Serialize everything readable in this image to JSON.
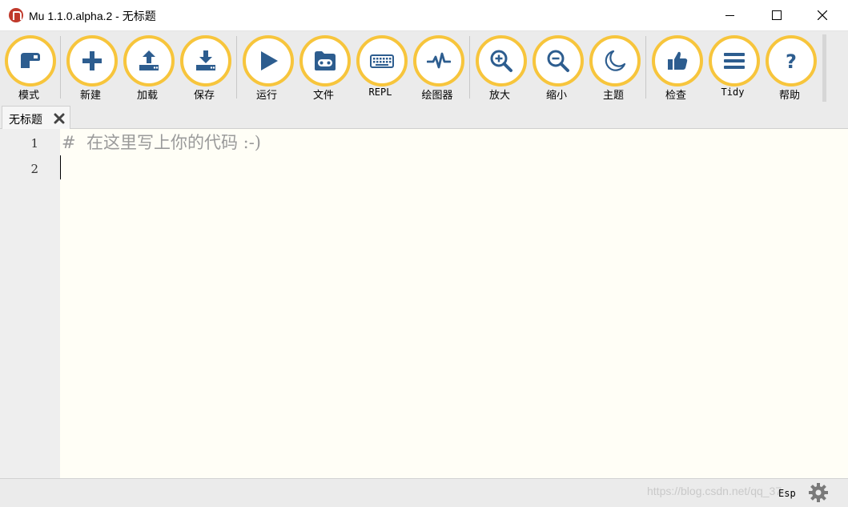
{
  "window": {
    "title": "Mu 1.1.0.alpha.2 - 无标题"
  },
  "toolbar": {
    "buttons": [
      {
        "id": "mode",
        "label": "模式",
        "icon": "mode-icon"
      },
      {
        "id": "new",
        "label": "新建",
        "icon": "plus-icon"
      },
      {
        "id": "load",
        "label": "加载",
        "icon": "upload-icon"
      },
      {
        "id": "save",
        "label": "保存",
        "icon": "download-icon"
      },
      {
        "id": "run",
        "label": "运行",
        "icon": "play-icon"
      },
      {
        "id": "files",
        "label": "文件",
        "icon": "microbit-icon"
      },
      {
        "id": "repl",
        "label": "REPL",
        "icon": "keyboard-icon"
      },
      {
        "id": "plotter",
        "label": "绘图器",
        "icon": "pulse-icon"
      },
      {
        "id": "zoom-in",
        "label": "放大",
        "icon": "zoom-in-icon"
      },
      {
        "id": "zoom-out",
        "label": "缩小",
        "icon": "zoom-out-icon"
      },
      {
        "id": "theme",
        "label": "主题",
        "icon": "moon-icon"
      },
      {
        "id": "check",
        "label": "检查",
        "icon": "thumbs-up-icon"
      },
      {
        "id": "tidy",
        "label": "Tidy",
        "icon": "lines-icon"
      },
      {
        "id": "help",
        "label": "帮助",
        "icon": "question-icon"
      }
    ]
  },
  "tabs": [
    {
      "label": "无标题"
    }
  ],
  "editor": {
    "line_numbers": [
      "1",
      "2"
    ],
    "lines": [
      "#  在这里写上你的代码 :-)",
      ""
    ]
  },
  "statusbar": {
    "mode": "Esp",
    "watermark": "https://blog.csdn.net/qq_37"
  },
  "colors": {
    "accent_ring": "#f7c53c",
    "icon_blue": "#2d5d8f",
    "editor_bg": "#fffef6"
  }
}
